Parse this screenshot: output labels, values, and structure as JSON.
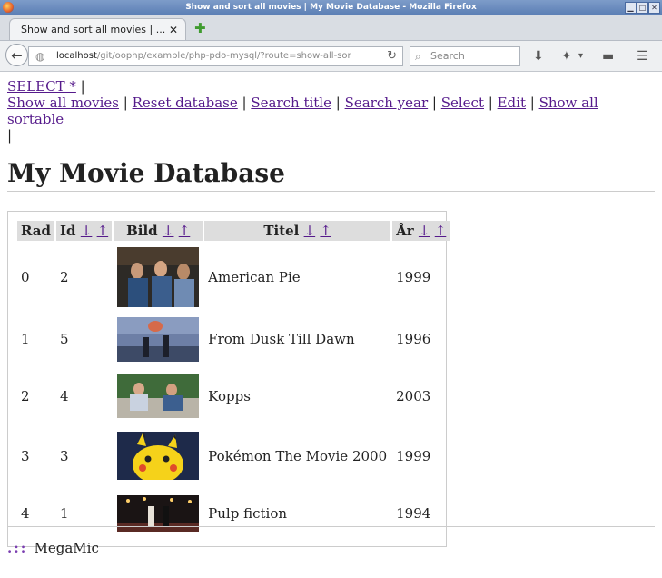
{
  "window": {
    "title": "Show and sort all movies | My Movie Database - Mozilla Firefox"
  },
  "tab": {
    "label": "Show and sort all movies | ..."
  },
  "url": {
    "host": "localhost",
    "path": "/git/oophp/example/php-pdo-mysql/?route=show-all-sor"
  },
  "search": {
    "placeholder": "Search"
  },
  "nav": {
    "links": [
      "SELECT *",
      "Show all movies",
      "Reset database",
      "Search title",
      "Search year",
      "Select",
      "Edit",
      "Show all sortable"
    ]
  },
  "page": {
    "title": "My Movie Database"
  },
  "table": {
    "headers": {
      "rad": "Rad",
      "id": "Id",
      "bild": "Bild",
      "titel": "Titel",
      "ar": "År"
    },
    "sort_down": "↓",
    "sort_up": "↑",
    "rows": [
      {
        "rad": "0",
        "id": "2",
        "title": "American Pie",
        "year": "1999"
      },
      {
        "rad": "1",
        "id": "5",
        "title": "From Dusk Till Dawn",
        "year": "1996"
      },
      {
        "rad": "2",
        "id": "4",
        "title": "Kopps",
        "year": "2003"
      },
      {
        "rad": "3",
        "id": "3",
        "title": "Pokémon The Movie 2000",
        "year": "1999"
      },
      {
        "rad": "4",
        "id": "1",
        "title": "Pulp fiction",
        "year": "1994"
      }
    ]
  },
  "footer": {
    "text": "MegaMic"
  }
}
